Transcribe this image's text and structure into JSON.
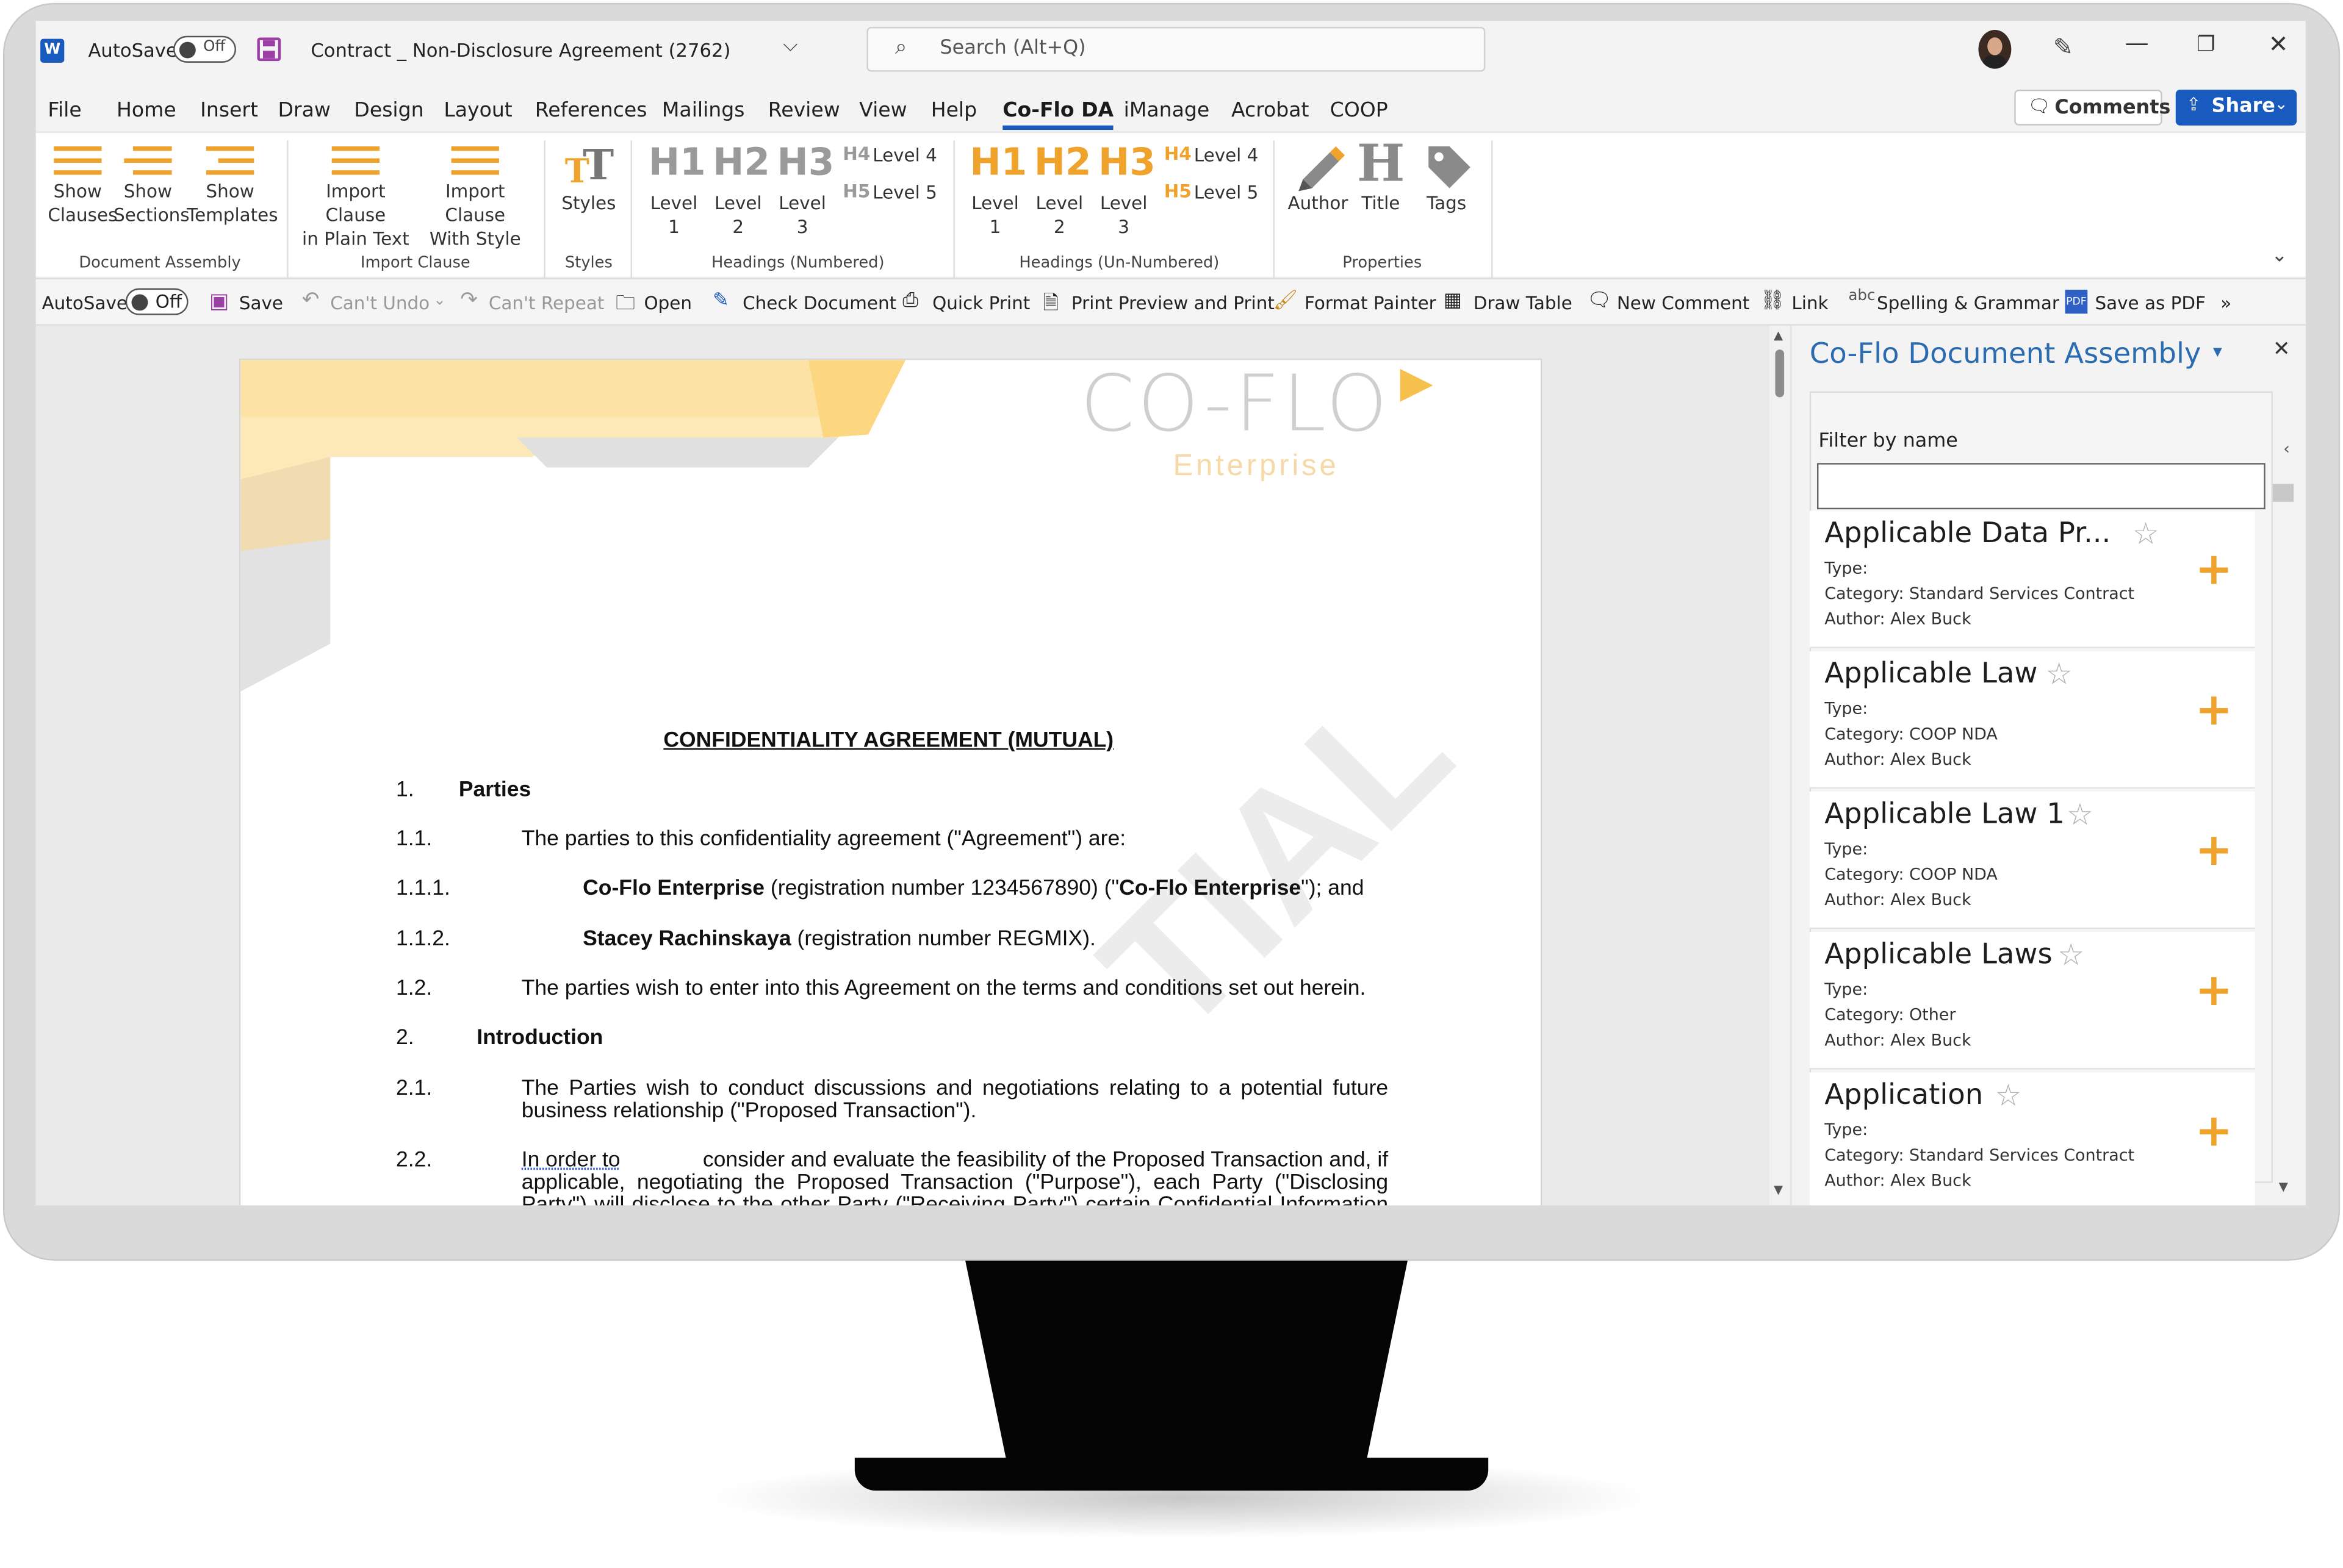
{
  "window": {
    "autosave_label": "AutoSave",
    "autosave_state": "Off",
    "title": "Contract _ Non-Disclosure Agreement (2762)",
    "search_placeholder": "Search (Alt+Q)",
    "comments_label": "Comments",
    "share_label": "Share"
  },
  "tabs": [
    "File",
    "Home",
    "Insert",
    "Draw",
    "Design",
    "Layout",
    "References",
    "Mailings",
    "Review",
    "View",
    "Help",
    "Co-Flo DA",
    "iManage",
    "Acrobat",
    "COOP"
  ],
  "ribbon": {
    "document_assembly": {
      "group": "Document Assembly",
      "show_clauses": [
        "Show",
        "Clauses"
      ],
      "show_sections": [
        "Show",
        "Sections"
      ],
      "show_templates": [
        "Show",
        "Templates"
      ]
    },
    "import_clause": {
      "group": "Import Clause",
      "plain": [
        "Import Clause",
        "in Plain Text"
      ],
      "style": [
        "Import Clause",
        "With Style"
      ]
    },
    "styles": {
      "group": "Styles",
      "label": "Styles"
    },
    "headings_numbered": {
      "group": "Headings (Numbered)",
      "level_word": "Level",
      "h1": "H1",
      "h2": "H2",
      "h3": "H3",
      "l1": "1",
      "l2": "2",
      "l3": "3",
      "h4": "H4",
      "h5": "H5",
      "level4": "Level 4",
      "level5": "Level 5"
    },
    "headings_unnumbered": {
      "group": "Headings (Un-Numbered)",
      "level_word": "Level",
      "h1": "H1",
      "h2": "H2",
      "h3": "H3",
      "l1": "1",
      "l2": "2",
      "l3": "3",
      "h4": "H4",
      "h5": "H5",
      "level4": "Level 4",
      "level5": "Level 5"
    },
    "properties": {
      "group": "Properties",
      "author": "Author",
      "title": "Title",
      "tags": "Tags"
    }
  },
  "qat": {
    "autosave": "AutoSave",
    "autosave_state": "Off",
    "save": "Save",
    "cant_undo": "Can't Undo",
    "cant_repeat": "Can't Repeat",
    "open": "Open",
    "check_document": "Check Document",
    "quick_print": "Quick Print",
    "print_preview": "Print Preview and Print",
    "format_painter": "Format Painter",
    "draw_table": "Draw Table",
    "new_comment": "New Comment",
    "link": "Link",
    "spelling": "Spelling & Grammar",
    "save_pdf": "Save as PDF",
    "more": "»"
  },
  "document": {
    "logo_text": "CO-FLO",
    "logo_sub": "Enterprise",
    "heading": "CONFIDENTIALITY AGREEMENT (MUTUAL)",
    "s1_num": "1.",
    "s1_title": "Parties",
    "p1_1_num": "1.1.",
    "p1_1": "The parties to this confidentiality agreement (\"Agreement\") are:",
    "p1_1_1_num": "1.1.1.",
    "p1_1_1_bold": "Co-Flo Enterprise",
    "p1_1_1_mid": " (registration number 1234567890) (\"",
    "p1_1_1_bold2": "Co-Flo Enterprise",
    "p1_1_1_end": "\"); and",
    "p1_1_2_num": "1.1.2.",
    "p1_1_2_bold": "Stacey Rachinskaya",
    "p1_1_2_end": " (registration number REGMIX).",
    "p1_2_num": "1.2.",
    "p1_2": "The parties wish to enter into this Agreement on the terms and conditions set out herein.",
    "s2_num": "2.",
    "s2_title": "Introduction",
    "p2_1_num": "2.1.",
    "p2_1_a": "The Parties wish to conduct discussions and negotiations relating to a potential future",
    "p2_1_b": "business relationship (\"Proposed Transaction\").",
    "p2_2_num": "2.2.",
    "p2_2_a_link": "In order to",
    "p2_2_a": " consider and evaluate the feasibility of the Proposed Transaction and, if",
    "p2_2_b": "applicable, negotiating the Proposed Transaction (\"Purpose\"), each Party (\"Disclosing",
    "p2_2_c": "Party\") will disclose to the other Party (\"Receiving Party\") certain Confidential Information",
    "watermark": "TIAL"
  },
  "pane": {
    "title": "Co-Flo Document Assembly",
    "filter_label": "Filter by name",
    "filter_value": "",
    "type_label": "Type:",
    "items": [
      {
        "title": "Applicable Data Pr...",
        "category": "Category: Standard Services Contract",
        "author": "Author: Alex Buck"
      },
      {
        "title": "Applicable Law",
        "category": "Category: COOP NDA",
        "author": "Author: Alex Buck"
      },
      {
        "title": "Applicable Law 1",
        "category": "Category: COOP NDA",
        "author": "Author: Alex Buck"
      },
      {
        "title": "Applicable Laws",
        "category": "Category: Other",
        "author": "Author: Alex Buck"
      },
      {
        "title": "Application",
        "category": "Category: Standard Services Contract",
        "author": "Author: Alex Buck"
      }
    ]
  },
  "colors": {
    "accent_orange": "#f0a32c",
    "word_blue": "#185abd",
    "pane_title_blue": "#2b6cb0"
  }
}
